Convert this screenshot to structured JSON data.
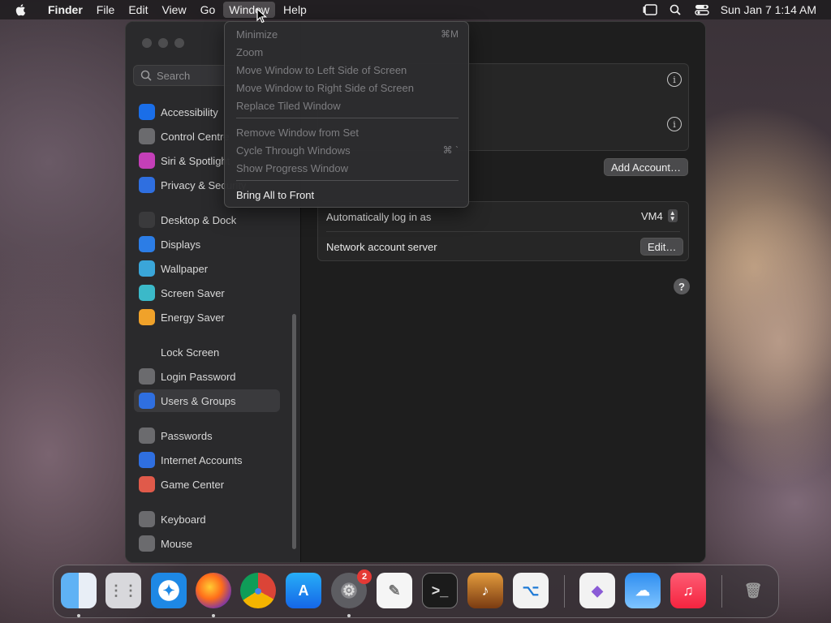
{
  "menubar": {
    "app_name": "Finder",
    "items": [
      "File",
      "Edit",
      "View",
      "Go",
      "Window",
      "Help"
    ],
    "clock": "Sun Jan 7  1:14 AM"
  },
  "window_menu": {
    "items": [
      {
        "label": "Minimize",
        "shortcut": "⌘M",
        "enabled": false
      },
      {
        "label": "Zoom",
        "shortcut": "",
        "enabled": false
      },
      {
        "label": "Move Window to Left Side of Screen",
        "shortcut": "",
        "enabled": false
      },
      {
        "label": "Move Window to Right Side of Screen",
        "shortcut": "",
        "enabled": false
      },
      {
        "label": "Replace Tiled Window",
        "shortcut": "",
        "enabled": false
      },
      {
        "label": "Remove Window from Set",
        "shortcut": "",
        "enabled": false
      },
      {
        "label": "Cycle Through Windows",
        "shortcut": "⌘ `",
        "enabled": false
      },
      {
        "label": "Show Progress Window",
        "shortcut": "",
        "enabled": false
      },
      {
        "label": "Bring All to Front",
        "shortcut": "",
        "enabled": true
      }
    ]
  },
  "sidebar": {
    "search_placeholder": "Search",
    "items": [
      {
        "label": "Accessibility",
        "color": "#1a6ee8"
      },
      {
        "label": "Control Centre",
        "color": "#6b6b6e"
      },
      {
        "label": "Siri & Spotlight",
        "color": "#c43fb8"
      },
      {
        "label": "Privacy & Security",
        "color": "#2f6fe0"
      },
      {
        "label": "Desktop & Dock",
        "color": "#3a3a3c"
      },
      {
        "label": "Displays",
        "color": "#2c7de6"
      },
      {
        "label": "Wallpaper",
        "color": "#3aa6d9"
      },
      {
        "label": "Screen Saver",
        "color": "#3bb9c9"
      },
      {
        "label": "Energy Saver",
        "color": "#f0a22a"
      },
      {
        "label": "Lock Screen",
        "color": "#2a2a2c"
      },
      {
        "label": "Login Password",
        "color": "#6b6b6e"
      },
      {
        "label": "Users & Groups",
        "color": "#2f6fe0"
      },
      {
        "label": "Passwords",
        "color": "#6b6b6e"
      },
      {
        "label": "Internet Accounts",
        "color": "#2f6fe0"
      },
      {
        "label": "Game Center",
        "color": "#e05a4a"
      },
      {
        "label": "Keyboard",
        "color": "#6b6b6e"
      },
      {
        "label": "Mouse",
        "color": "#6b6b6e"
      }
    ]
  },
  "content": {
    "add_account_label": "Add Account…",
    "auto_login_label": "Automatically log in as",
    "auto_login_value": "VM4",
    "network_server_label": "Network account server",
    "edit_label": "Edit…",
    "help_glyph": "?",
    "info_glyph": "i"
  },
  "dock": {
    "apps": [
      "Finder",
      "Launchpad",
      "Safari",
      "Firefox",
      "Chrome",
      "App Store",
      "System Settings",
      "TextEdit",
      "Terminal",
      "GarageBand",
      "VS Code",
      "Visual Studio",
      "Weather",
      "Music",
      "Trash"
    ],
    "settings_badge": "2"
  }
}
